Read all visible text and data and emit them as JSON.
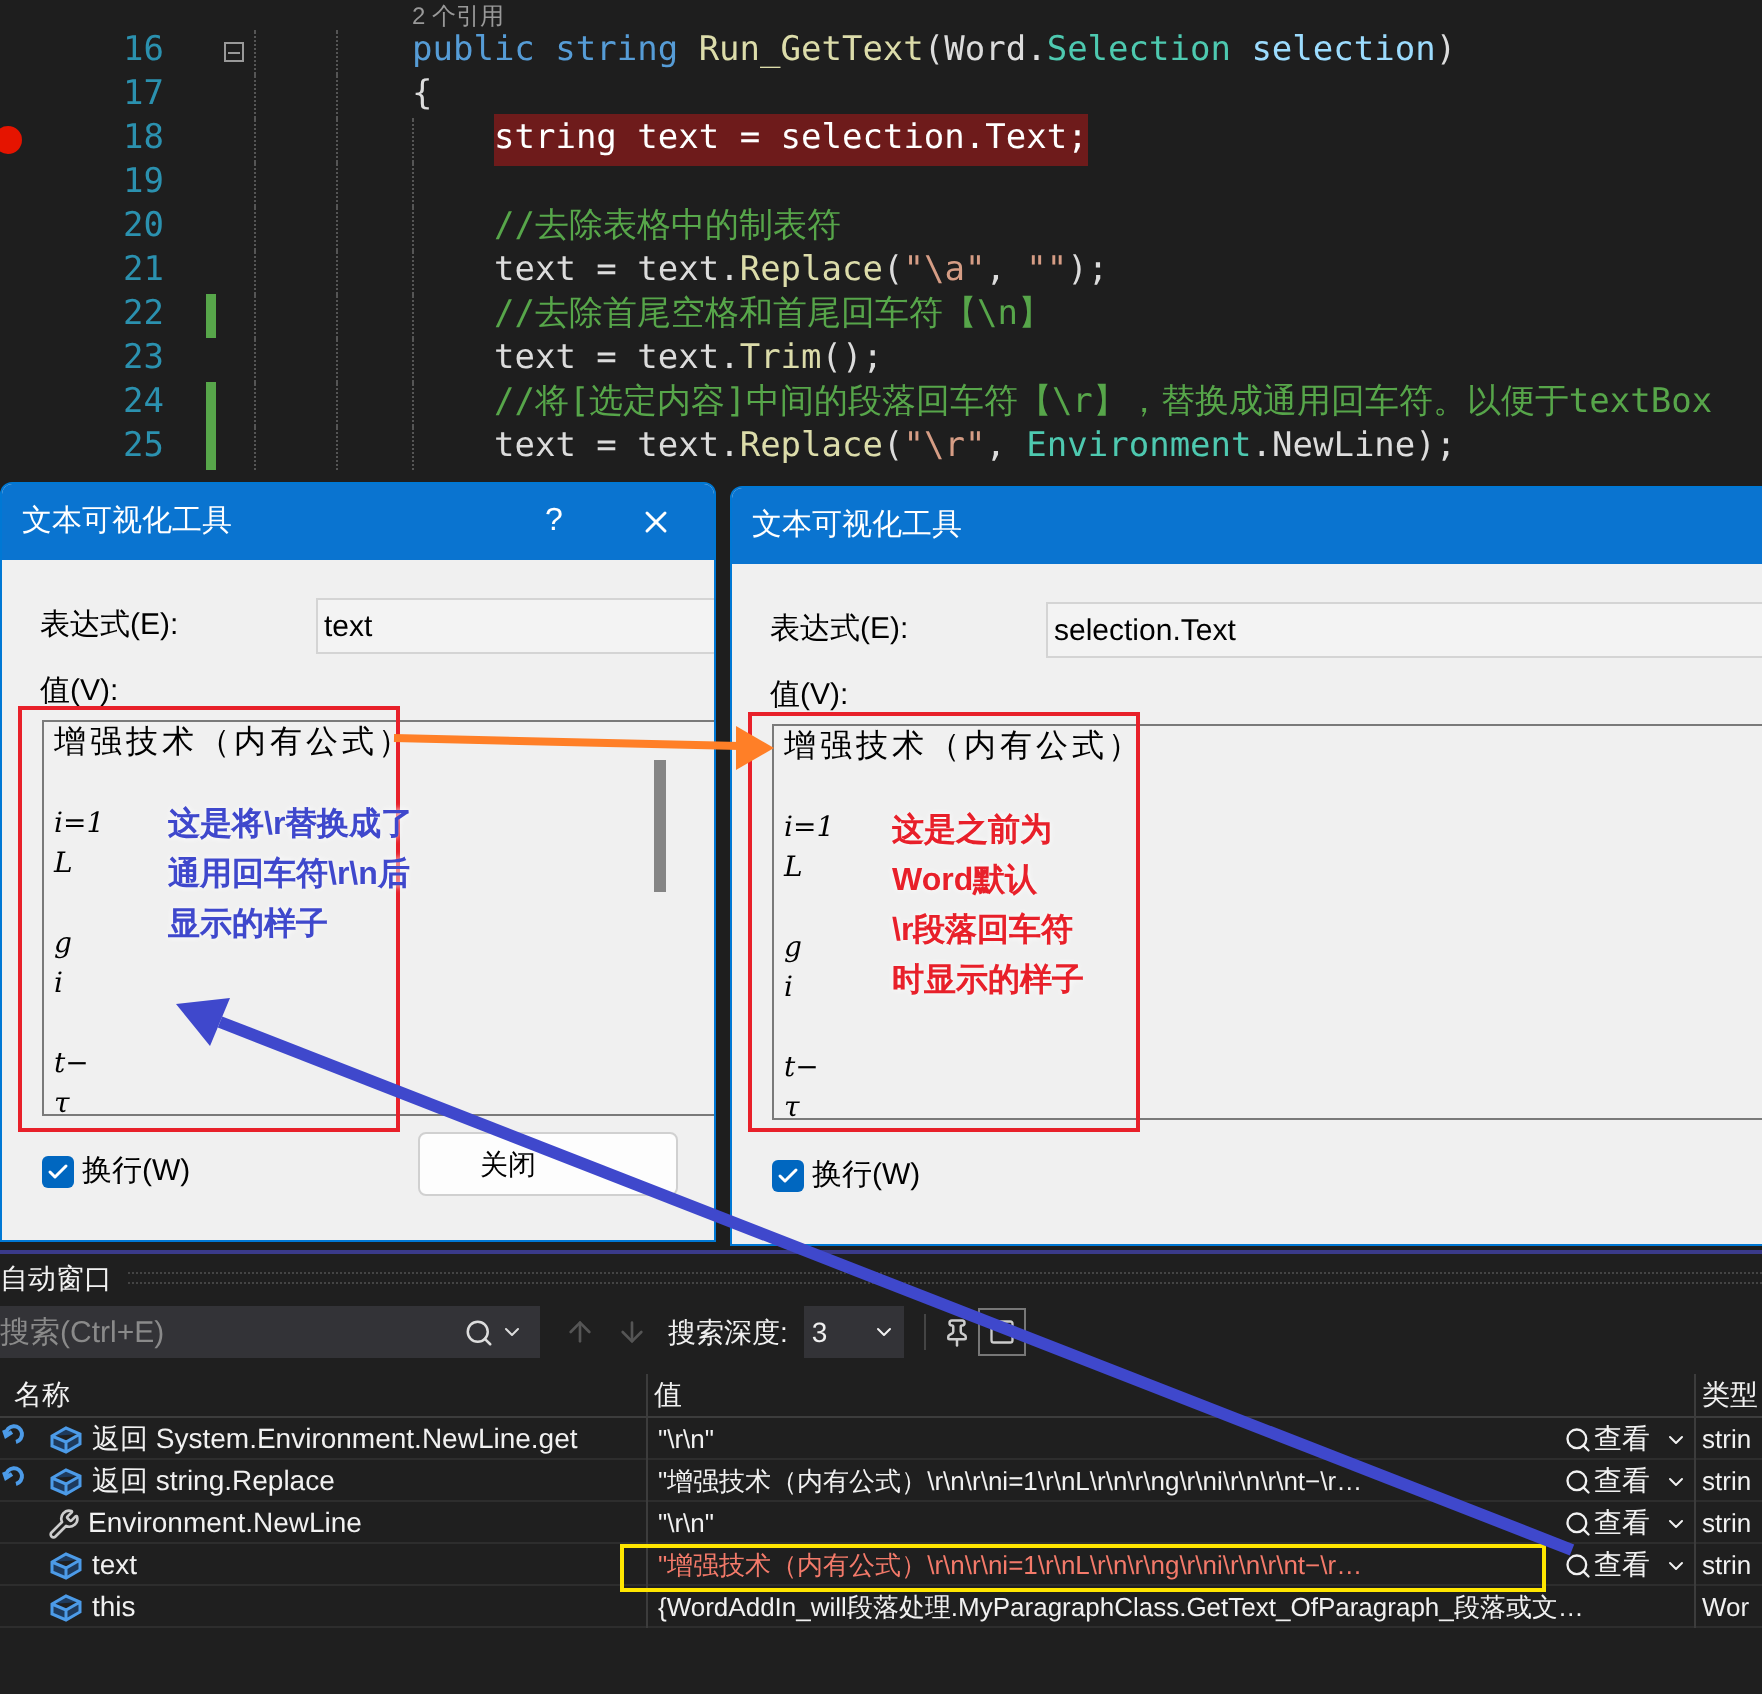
{
  "editor": {
    "codelens": "2 个引用",
    "lines": [
      {
        "number": "16",
        "inner": false,
        "breakpoint": false,
        "changed": false,
        "foldable": true,
        "tokens": [
          {
            "text": "public",
            "kind": "keyword"
          },
          {
            "text": " string",
            "kind": "keyword"
          },
          {
            "text": " Run_GetText",
            "kind": "method"
          },
          {
            "text": "(Word.",
            "kind": "plain"
          },
          {
            "text": "Selection",
            "kind": "type"
          },
          {
            "text": " selection",
            "kind": "param"
          },
          {
            "text": ")",
            "kind": "plain"
          }
        ]
      },
      {
        "number": "17",
        "inner": false,
        "breakpoint": false,
        "changed": false,
        "foldable": false,
        "tokens": [
          {
            "text": "{",
            "kind": "plain"
          }
        ]
      },
      {
        "number": "18",
        "inner": true,
        "breakpoint": true,
        "changed": false,
        "foldable": false,
        "tokens": [
          {
            "text": "string text = selection.Text;",
            "kind": "plain"
          }
        ]
      },
      {
        "number": "19",
        "inner": true,
        "breakpoint": false,
        "changed": false,
        "foldable": false
      },
      {
        "number": "20",
        "inner": true,
        "breakpoint": false,
        "changed": false,
        "foldable": false,
        "tokens": [
          {
            "text": "//去除表格中的制表符",
            "kind": "comment"
          }
        ]
      },
      {
        "number": "21",
        "inner": true,
        "breakpoint": false,
        "changed": false,
        "foldable": false,
        "tokens": [
          {
            "text": "text = text.",
            "kind": "plain"
          },
          {
            "text": "Replace",
            "kind": "method"
          },
          {
            "text": "(",
            "kind": "plain"
          },
          {
            "text": "\"\\a\"",
            "kind": "string"
          },
          {
            "text": ", ",
            "kind": "plain"
          },
          {
            "text": "\"\"",
            "kind": "string"
          },
          {
            "text": ");",
            "kind": "plain"
          }
        ]
      },
      {
        "number": "22",
        "inner": true,
        "breakpoint": false,
        "changed": true,
        "foldable": false,
        "tokens": [
          {
            "text": "//去除首尾空格和首尾回车符【\\n】",
            "kind": "comment"
          }
        ]
      },
      {
        "number": "23",
        "inner": true,
        "breakpoint": false,
        "changed": false,
        "foldable": false,
        "tokens": [
          {
            "text": "text = text.",
            "kind": "plain"
          },
          {
            "text": "Trim",
            "kind": "method"
          },
          {
            "text": "();",
            "kind": "plain"
          }
        ]
      },
      {
        "number": "24",
        "inner": true,
        "breakpoint": false,
        "changed": true,
        "foldable": false,
        "tokens": [
          {
            "text": "//将[选定内容]中间的段落回车符【\\r】，替换成通用回车符。以便于textBox",
            "kind": "comment"
          }
        ]
      },
      {
        "number": "25",
        "inner": true,
        "breakpoint": false,
        "changed": true,
        "foldable": false,
        "tokens": [
          {
            "text": "text = text.",
            "kind": "plain"
          },
          {
            "text": "Replace",
            "kind": "method"
          },
          {
            "text": "(",
            "kind": "plain"
          },
          {
            "text": "\"\\r\"",
            "kind": "string"
          },
          {
            "text": ", ",
            "kind": "plain"
          },
          {
            "text": "Environment",
            "kind": "type"
          },
          {
            "text": ".NewLine);",
            "kind": "plain"
          }
        ]
      }
    ]
  },
  "dialogs": [
    {
      "title": "文本可视化工具",
      "help": "?",
      "closable": true,
      "expression_label": "表达式(E):",
      "expression": "text",
      "value_label": "值(V):",
      "value_lines": [
        {
          "text": "增强技术（内有公式）",
          "blank_before": false
        },
        {
          "text": "i=1",
          "blank_before": true
        },
        {
          "text": "L",
          "blank_before": false
        },
        {
          "text": "g",
          "blank_before": true
        },
        {
          "text": "i",
          "blank_before": false
        },
        {
          "text": "t−",
          "blank_before": true
        },
        {
          "text": "τ",
          "blank_before": false
        }
      ],
      "scrollbar": true,
      "wrap": {
        "label": "换行(W)",
        "checked": true
      },
      "close_button": "关闭"
    },
    {
      "title": "文本可视化工具",
      "closable": false,
      "expression_label": "表达式(E):",
      "expression": "selection.Text",
      "value_label": "值(V):",
      "value_lines": [
        {
          "text": "增强技术（内有公式）",
          "blank_before": false
        },
        {
          "text": "i=1",
          "blank_before": true
        },
        {
          "text": "L",
          "blank_before": false
        },
        {
          "text": "g",
          "blank_before": true
        },
        {
          "text": "i",
          "blank_before": false
        },
        {
          "text": "t−",
          "blank_before": true
        },
        {
          "text": "τ",
          "blank_before": false
        }
      ],
      "scrollbar": false,
      "wrap": {
        "label": "换行(W)",
        "checked": true
      }
    }
  ],
  "autos": {
    "title": "自动窗口",
    "search": {
      "placeholder": "搜索(Ctrl+E)"
    },
    "depth_label": "搜索深度:",
    "depth": "3",
    "columns": [
      "名称",
      "值",
      "类型"
    ],
    "rows": [
      {
        "kind": "return",
        "name": "返回 System.Environment.NewLine.get",
        "value": "\"\\r\\n\"",
        "viewer": "查看",
        "type": "strin",
        "changed": false
      },
      {
        "kind": "return",
        "name": "返回 string.Replace",
        "value": "\"增强技术（内有公式）\\r\\n\\r\\ni=1\\r\\nL\\r\\n\\r\\ng\\r\\ni\\r\\n\\r\\nt−\\r…",
        "viewer": "查看",
        "type": "strin",
        "changed": false
      },
      {
        "kind": "property",
        "name": "Environment.NewLine",
        "value": "\"\\r\\n\"",
        "viewer": "查看",
        "type": "strin",
        "changed": false
      },
      {
        "kind": "variable",
        "name": "text",
        "value": "\"增强技术（内有公式）\\r\\n\\r\\ni=1\\r\\nL\\r\\n\\r\\ng\\r\\ni\\r\\n\\r\\nt−\\r…",
        "viewer": "查看",
        "type": "strin",
        "changed": true
      },
      {
        "kind": "variable",
        "name": "this",
        "value": "{WordAddIn_will段落处理.MyParagraphClass.GetText_OfParagraph_段落或文…",
        "type": "Wor",
        "changed": false
      }
    ]
  },
  "annotations": {
    "frames": [
      {
        "color": "#e8202a"
      },
      {
        "color": "#e8202a"
      },
      {
        "color": "#ffe600"
      }
    ],
    "arrows": [
      {
        "color": "#ff7f27"
      },
      {
        "color": "#3f48cc"
      }
    ],
    "notes": [
      {
        "lines": [
          "这是将\\r替换成了",
          "通用回车符\\r\\n后",
          "显示的样子"
        ],
        "color": "#3f48cc"
      },
      {
        "lines": [
          "这是之前为",
          "Word默认",
          "\\r段落回车符",
          "时显示的样子"
        ],
        "color": "#e8202a"
      }
    ]
  }
}
